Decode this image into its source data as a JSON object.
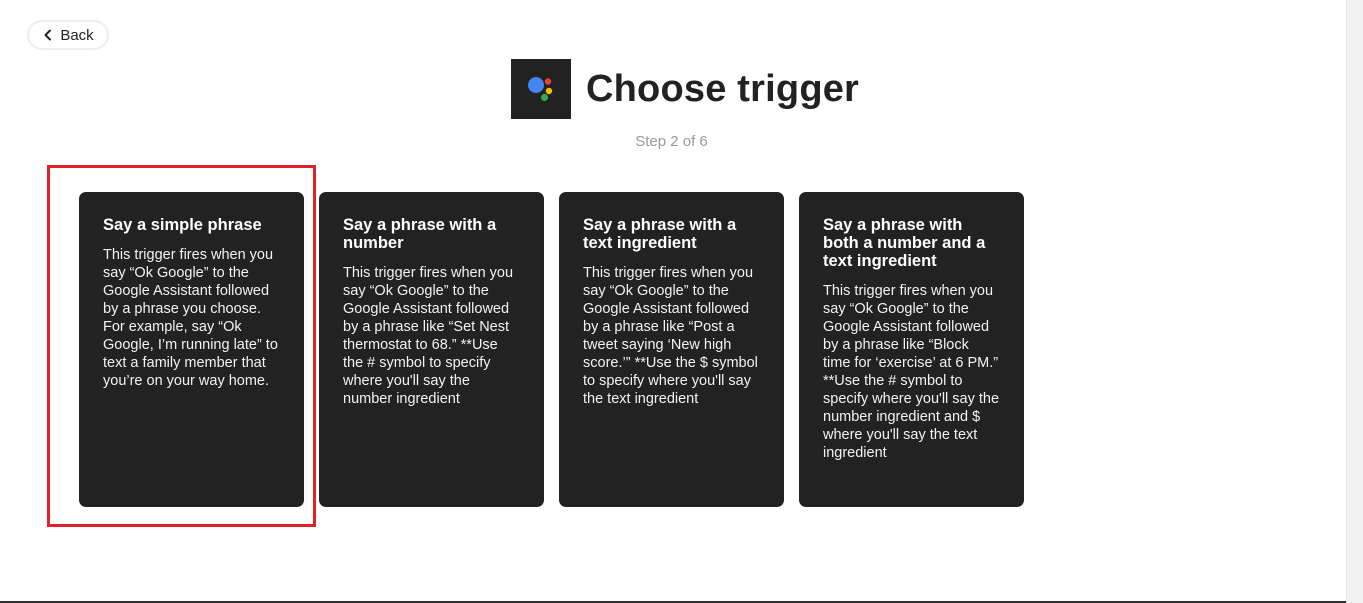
{
  "nav": {
    "back_label": "Back"
  },
  "header": {
    "title": "Choose trigger",
    "step": "Step 2 of 6",
    "service_icon": "google-assistant-icon"
  },
  "cards": [
    {
      "title": "Say a simple phrase",
      "description": "This trigger fires when you say “Ok Google” to the Google Assistant followed by a phrase you choose. For example, say “Ok Google, I’m running late” to text a family member that you’re on your way home."
    },
    {
      "title": "Say a phrase with a number",
      "description": "This trigger fires when you say “Ok Google” to the Google Assistant followed by a phrase like “Set Nest thermostat to 68.” **Use the # symbol to specify where you'll say the number ingredient"
    },
    {
      "title": "Say a phrase with a text ingredient",
      "description": "This trigger fires when you say “Ok Google” to the Google Assistant followed by a phrase like “Post a tweet saying ‘New high score.’” **Use the $ symbol to specify where you'll say the text ingredient"
    },
    {
      "title": "Say a phrase with both a number and a text ingredient",
      "description": "This trigger fires when you say “Ok Google” to the Google Assistant followed by a phrase like “Block time for ‘exercise’ at 6 PM.” **Use the # symbol to specify where you'll say the number ingredient and $ where you'll say the text ingredient"
    }
  ],
  "colors": {
    "card_bg": "#222222",
    "highlight": "#e0202a",
    "dot_blue": "#4285f4",
    "dot_red": "#ea4335",
    "dot_yellow": "#fbbc05",
    "dot_green": "#34a853"
  }
}
